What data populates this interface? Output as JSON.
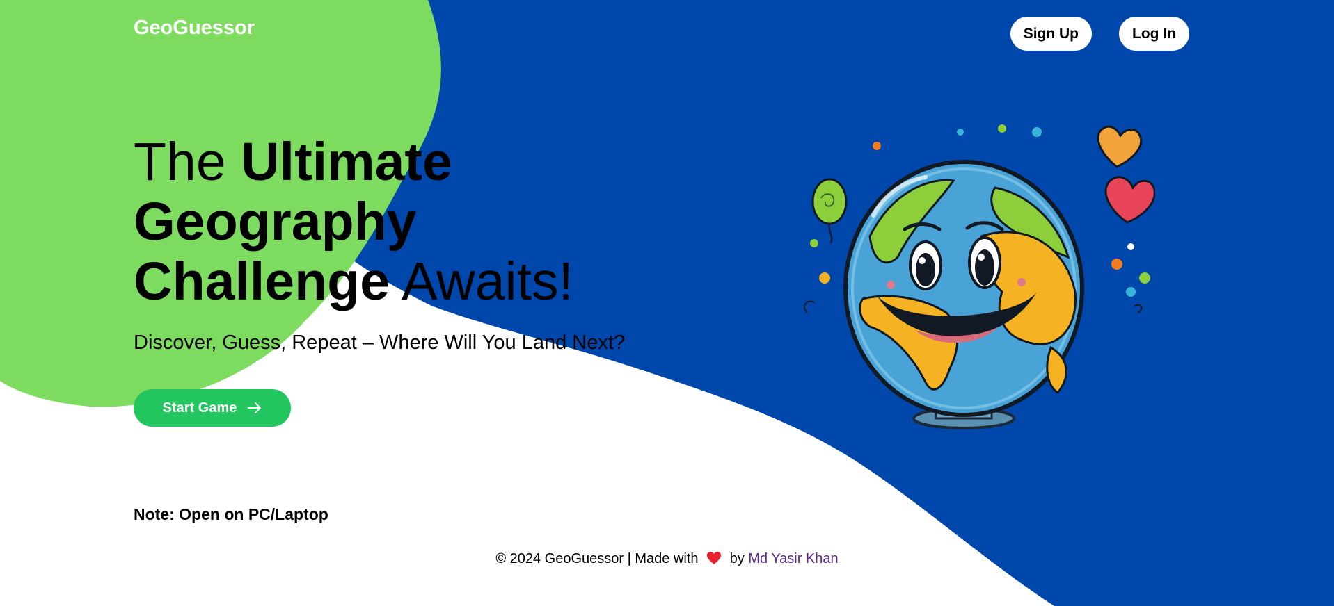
{
  "brand": {
    "name": "GeoGuessor"
  },
  "header": {
    "signup_label": "Sign Up",
    "login_label": "Log In"
  },
  "hero": {
    "headline_the": "The ",
    "headline_ultimate": "Ultimate",
    "headline_geography": "Geography",
    "headline_challenge": "Challenge",
    "headline_awaits": " Awaits!",
    "subtitle": "Discover, Guess, Repeat – Where Will You Land Next?",
    "start_label": "Start Game",
    "start_icon": "arrow-right-icon",
    "illustration": "smiling-globe-illustration"
  },
  "note": {
    "text": "Note: Open on PC/Laptop"
  },
  "footer": {
    "prefix": "© 2024 GeoGuessor | Made with",
    "heart_icon": "heart-icon",
    "by": "by",
    "author": "Md Yasir Khan"
  },
  "colors": {
    "blue": "#0047ab",
    "green_blob": "#7ddc5f",
    "start_button": "#22c55e",
    "author_link": "#5b2c8f"
  }
}
